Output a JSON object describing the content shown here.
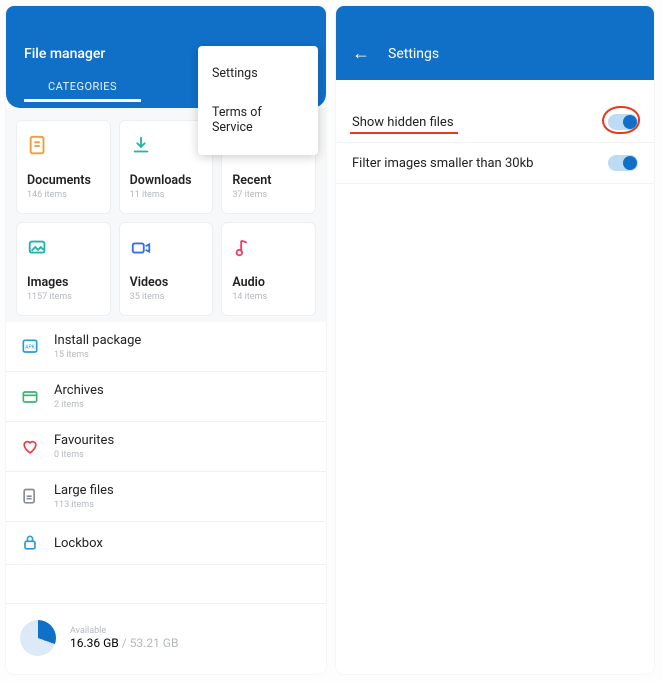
{
  "left": {
    "title": "File manager",
    "tab": "CATEGORIES",
    "menu": {
      "settings": "Settings",
      "terms": "Terms of Service"
    },
    "cats": [
      {
        "label": "Documents",
        "sub": "146 items",
        "icon": "file"
      },
      {
        "label": "Downloads",
        "sub": "11 items",
        "icon": "download"
      },
      {
        "label": "Recent",
        "sub": "37 items",
        "icon": "clock"
      },
      {
        "label": "Images",
        "sub": "1157 items",
        "icon": "image"
      },
      {
        "label": "Videos",
        "sub": "35 items",
        "icon": "video"
      },
      {
        "label": "Audio",
        "sub": "14 items",
        "icon": "audio"
      }
    ],
    "rows": [
      {
        "label": "Install package",
        "sub": "15 items",
        "icon": "apk"
      },
      {
        "label": "Archives",
        "sub": "2 items",
        "icon": "archive"
      },
      {
        "label": "Favourites",
        "sub": "0 items",
        "icon": "heart"
      },
      {
        "label": "Large files",
        "sub": "113 items",
        "icon": "large"
      },
      {
        "label": "Lockbox",
        "sub": "",
        "icon": "lock"
      }
    ],
    "storage": {
      "available_label": "Available",
      "used": "16.36 GB",
      "sep": " / ",
      "total": "53.21 GB"
    }
  },
  "right": {
    "title": "Settings",
    "rows": [
      {
        "label": "Show hidden files",
        "highlighted": true,
        "toggle": true
      },
      {
        "label": "Filter images smaller than 30kb",
        "highlighted": false,
        "toggle": true
      }
    ]
  }
}
